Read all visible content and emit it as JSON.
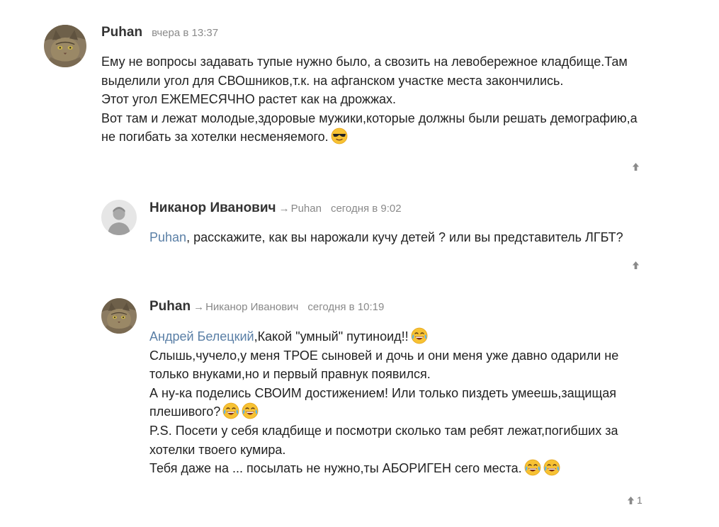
{
  "comments": [
    {
      "author": "Puhan",
      "reply_to": "",
      "date": "вчера в 13:37",
      "lines": [
        "Ему не вопросы задавать тупые нужно было, а свозить на левобережное кладбище.Там",
        "выделили угол для СВОшников,т.к. на афганском участке места закончились.",
        "Этот угол ЕЖЕМЕСЯЧНО растет как на дрожжах.",
        "Вот там и лежат молодые,здоровые мужики,которые должны были решать демографию,а",
        "не погибать за хотелки несменяемого."
      ],
      "emojis": [
        "sunglasses-emoji"
      ],
      "votes": ""
    },
    {
      "author": "Никанор Иванович",
      "arrow": "→",
      "reply_to": "Puhan",
      "date": "сегодня в 9:02",
      "mention": "Puhan",
      "lines": [
        ", расскажите, как вы нарожали кучу детей ? или вы представитель ЛГБТ?"
      ],
      "votes": ""
    },
    {
      "author": "Puhan",
      "arrow": "→",
      "reply_to": "Никанор Иванович",
      "date": "сегодня в 10:19",
      "mention": "Андрей Белецкий",
      "lines": [
        ",Какой \"умный\" путиноид!!",
        "Слышь,чучело,у меня ТРОЕ сыновей и дочь и они меня уже давно одарили не",
        "только внуками,но и первый правнук появился.",
        "А ну-ка поделись СВОИМ достижением! Или только пиздеть умеешь,защищая",
        "плешивого?",
        "P.S. Посети у себя кладбище и посмотри сколько там ребят лежат,погибших за",
        "хотелки твоего кумира.",
        "Тебя даже на ... посылать не нужно,ты АБОРИГЕН сего места."
      ],
      "emojis": [
        "laughing-crying-emoji"
      ],
      "votes": "1"
    }
  ],
  "colors": {
    "mention": "#5a7fa6",
    "meta": "#8a8a8a",
    "text": "#222222"
  },
  "icons": {
    "vote_up": "vote-up-icon"
  }
}
